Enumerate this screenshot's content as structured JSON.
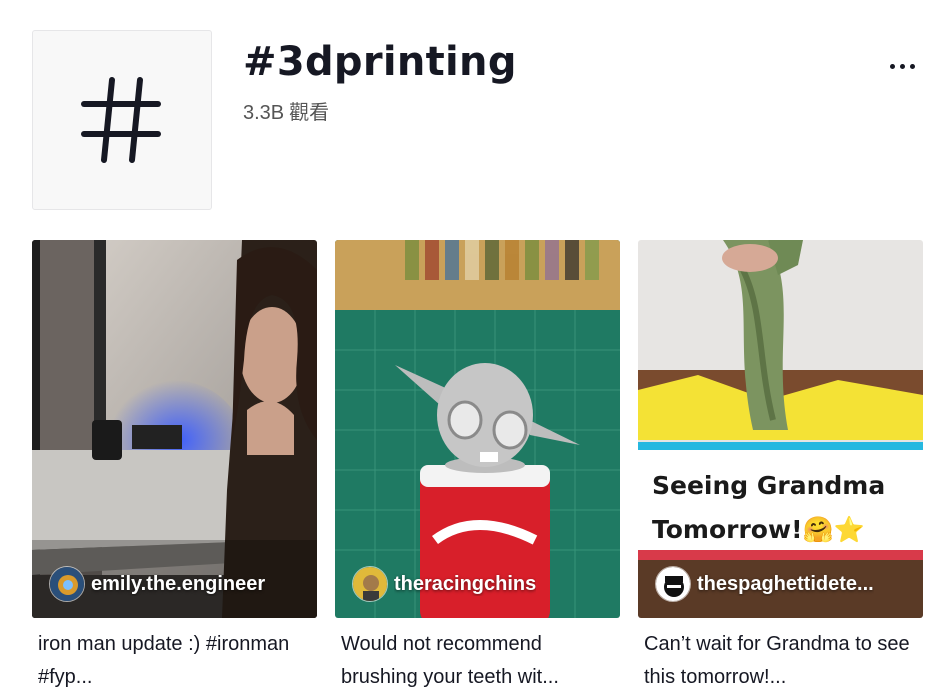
{
  "header": {
    "title": "#3dprinting",
    "views_count": "3.3B",
    "views_label": "觀看"
  },
  "videos": [
    {
      "author": "emily.the.engineer",
      "description": "iron man update :) #ironman #fyp..."
    },
    {
      "author": "theracingchins",
      "description": "Would not recommend brushing your teeth wit..."
    },
    {
      "author": "thespaghettidete...",
      "description": "Can’t wait for Grandma to see this tomorrow!...",
      "overlay_line1": "Seeing Grandma",
      "overlay_line2": "Tomorrow!🤗⭐"
    }
  ],
  "colors": {
    "text": "#161823",
    "muted": "#555555",
    "overlay_top_border": "#26b8e0",
    "overlay_bottom_border": "#d83a4a"
  },
  "icons": [
    "hashtag-icon",
    "more-icon"
  ]
}
